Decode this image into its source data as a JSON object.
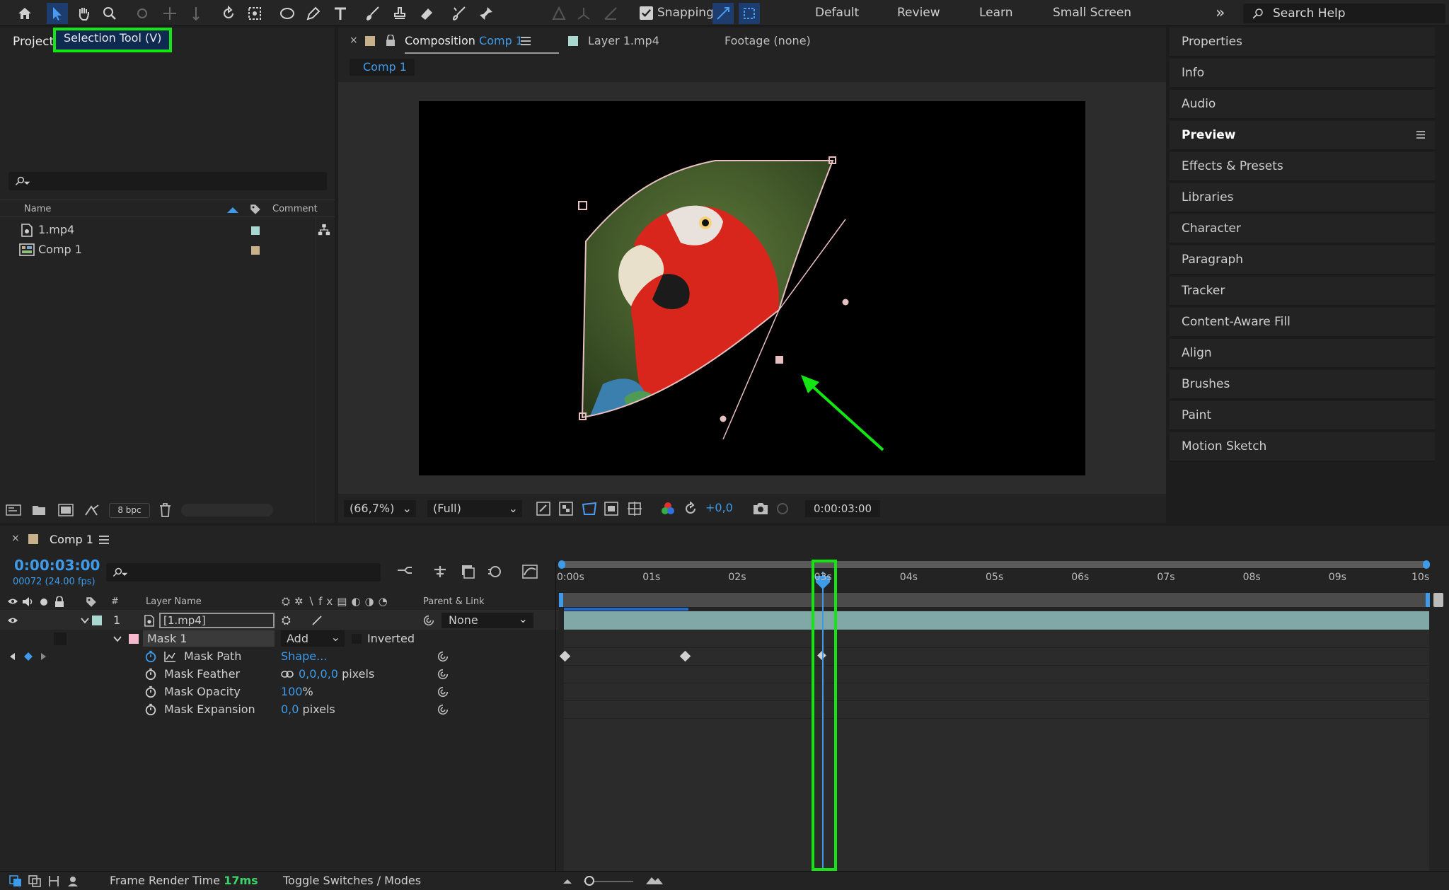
{
  "toolbar": {
    "snapping": "Snapping",
    "workspaces": [
      "Default",
      "Review",
      "Learn",
      "Small Screen"
    ],
    "more": "»",
    "search_placeholder": "Search Help"
  },
  "project": {
    "tab": "Project",
    "tooltip": "Selection Tool (V)",
    "columns": {
      "name": "Name",
      "comment": "Comment"
    },
    "items": [
      {
        "name": "1.mp4",
        "color": "#a8d8d0"
      },
      {
        "name": "Comp 1",
        "color": "#c8b08a"
      }
    ],
    "bpc": "8 bpc"
  },
  "viewer": {
    "tab_prefix": "Composition",
    "tab_comp": "Comp 1",
    "tab_layer": "Layer 1.mp4",
    "tab_footage": "Footage (none)",
    "breadcrumb": "Comp 1",
    "zoom": "(66,7%)",
    "resolution": "(Full)",
    "exposure": "+0,0",
    "timecode": "0:00:03:00"
  },
  "right_panel": {
    "items": [
      "Properties",
      "Info",
      "Audio",
      "Preview",
      "Effects & Presets",
      "Libraries",
      "Character",
      "Paragraph",
      "Tracker",
      "Content-Aware Fill",
      "Align",
      "Brushes",
      "Paint",
      "Motion Sketch"
    ]
  },
  "timeline": {
    "tab": "Comp 1",
    "time": "0:00:03:00",
    "frames": "00072 (24.00 fps)",
    "col_num": "#",
    "col_layer": "Layer Name",
    "col_parent": "Parent & Link",
    "layer": {
      "num": "1",
      "name": "[1.mp4]",
      "parent": "None"
    },
    "mask": {
      "name": "Mask 1",
      "mode": "Add",
      "inverted": "Inverted"
    },
    "props": [
      {
        "label": "Mask Path",
        "value": "Shape...",
        "unit": ""
      },
      {
        "label": "Mask Feather",
        "value": "0,0,0,0",
        "unit": "pixels"
      },
      {
        "label": "Mask Opacity",
        "value": "100",
        "unit": "%"
      },
      {
        "label": "Mask Expansion",
        "value": "0,0",
        "unit": "pixels"
      }
    ],
    "ticks": [
      "0:00s",
      "01s",
      "02s",
      "03s",
      "04s",
      "05s",
      "06s",
      "07s",
      "08s",
      "09s",
      "10s"
    ],
    "render_label": "Frame Render Time",
    "render_value": "17ms",
    "toggle": "Toggle Switches / Modes"
  }
}
